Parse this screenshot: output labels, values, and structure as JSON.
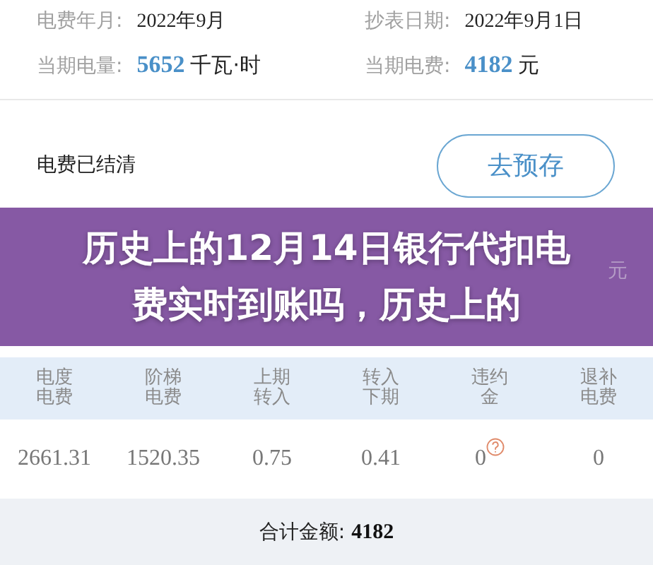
{
  "bill_info": [
    {
      "label": "电费年月:",
      "value": "2022年9月",
      "kind": "plain"
    },
    {
      "label": "抄表日期:",
      "value": "2022年9月1日",
      "kind": "plain"
    },
    {
      "label": "当期电量:",
      "value": "5652",
      "unit": "千瓦·时",
      "kind": "highlight"
    },
    {
      "label": "当期电费:",
      "value": "4182",
      "unit": "元",
      "kind": "highlight"
    }
  ],
  "status": {
    "text": "电费已结清",
    "button": "去预存"
  },
  "banner": {
    "title": "历史上的12月14日银行代扣电费实时到账吗，历史上的",
    "behind_text": "元"
  },
  "table": {
    "columns": [
      "电度电费",
      "阶梯电费",
      "上期转入",
      "转入下期",
      "违约金",
      "退补电费"
    ],
    "rows": [
      [
        {
          "text": "2661.31"
        },
        {
          "text": "1520.35"
        },
        {
          "text": "0.75"
        },
        {
          "text": "0.41"
        },
        {
          "text": "0",
          "help": true
        },
        {
          "text": "0"
        }
      ]
    ],
    "total": {
      "label": "合计金额:",
      "value": "4182"
    }
  }
}
